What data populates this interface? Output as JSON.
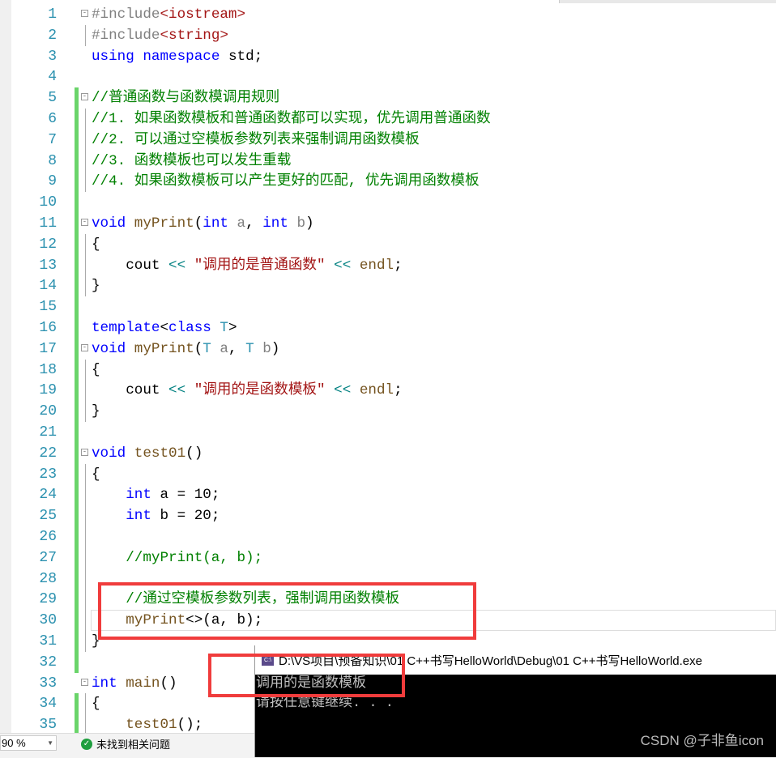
{
  "editor": {
    "lines": [
      [
        [
          "#include",
          "pp"
        ],
        [
          "<iostream>",
          "inc"
        ]
      ],
      [
        [
          "#include",
          "pp"
        ],
        [
          "<string>",
          "inc"
        ]
      ],
      [
        [
          "using",
          "k"
        ],
        [
          " ",
          "d"
        ],
        [
          "namespace",
          "k"
        ],
        [
          " std;",
          "d"
        ]
      ],
      [],
      [
        [
          "//普通函数与函数模调用规则",
          "c"
        ]
      ],
      [
        [
          "//1. 如果函数模板和普通函数都可以实现，优先调用普通函数",
          "c"
        ]
      ],
      [
        [
          "//2. 可以通过空模板参数列表来强制调用函数模板",
          "c"
        ]
      ],
      [
        [
          "//3. 函数模板也可以发生重载",
          "c"
        ]
      ],
      [
        [
          "//4. 如果函数模板可以产生更好的匹配, 优先调用函数模板",
          "c"
        ]
      ],
      [],
      [
        [
          "void",
          "k"
        ],
        [
          " ",
          "d"
        ],
        [
          "myPrint",
          "fn"
        ],
        [
          "(",
          "d"
        ],
        [
          "int",
          "k"
        ],
        [
          " ",
          "d"
        ],
        [
          "a",
          "p"
        ],
        [
          ", ",
          "d"
        ],
        [
          "int",
          "k"
        ],
        [
          " ",
          "d"
        ],
        [
          "b",
          "p"
        ],
        [
          ")",
          "d"
        ]
      ],
      [
        [
          "{",
          "d"
        ]
      ],
      [
        [
          "    cout ",
          "d"
        ],
        [
          "<<",
          "op"
        ],
        [
          " ",
          "d"
        ],
        [
          "\"调用的是普通函数\"",
          "s"
        ],
        [
          " ",
          "d"
        ],
        [
          "<<",
          "op"
        ],
        [
          " ",
          "d"
        ],
        [
          "endl",
          "fn"
        ],
        [
          ";",
          "d"
        ]
      ],
      [
        [
          "}",
          "d"
        ]
      ],
      [],
      [
        [
          "template",
          "k"
        ],
        [
          "<",
          "d"
        ],
        [
          "class",
          "k"
        ],
        [
          " ",
          "d"
        ],
        [
          "T",
          "t"
        ],
        [
          ">",
          "d"
        ]
      ],
      [
        [
          "void",
          "k"
        ],
        [
          " ",
          "d"
        ],
        [
          "myPrint",
          "fn"
        ],
        [
          "(",
          "d"
        ],
        [
          "T",
          "t"
        ],
        [
          " ",
          "d"
        ],
        [
          "a",
          "p"
        ],
        [
          ", ",
          "d"
        ],
        [
          "T",
          "t"
        ],
        [
          " ",
          "d"
        ],
        [
          "b",
          "p"
        ],
        [
          ")",
          "d"
        ]
      ],
      [
        [
          "{",
          "d"
        ]
      ],
      [
        [
          "    cout ",
          "d"
        ],
        [
          "<<",
          "op"
        ],
        [
          " ",
          "d"
        ],
        [
          "\"调用的是函数模板\"",
          "s"
        ],
        [
          " ",
          "d"
        ],
        [
          "<<",
          "op"
        ],
        [
          " ",
          "d"
        ],
        [
          "endl",
          "fn"
        ],
        [
          ";",
          "d"
        ]
      ],
      [
        [
          "}",
          "d"
        ]
      ],
      [],
      [
        [
          "void",
          "k"
        ],
        [
          " ",
          "d"
        ],
        [
          "test01",
          "fn"
        ],
        [
          "()",
          "d"
        ]
      ],
      [
        [
          "{",
          "d"
        ]
      ],
      [
        [
          "    ",
          "d"
        ],
        [
          "int",
          "k"
        ],
        [
          " a = 10;",
          "d"
        ]
      ],
      [
        [
          "    ",
          "d"
        ],
        [
          "int",
          "k"
        ],
        [
          " b = 20;",
          "d"
        ]
      ],
      [],
      [
        [
          "    //myPrint(a, b);",
          "c"
        ]
      ],
      [],
      [
        [
          "    //通过空模板参数列表，强制调用函数模板",
          "c"
        ]
      ],
      [
        [
          "    ",
          "d"
        ],
        [
          "myPrint",
          "fn"
        ],
        [
          "<>(a, b);",
          "d"
        ]
      ],
      [
        [
          "}",
          "d"
        ]
      ],
      [],
      [
        [
          "int",
          "k"
        ],
        [
          " ",
          "d"
        ],
        [
          "main",
          "fn"
        ],
        [
          "()",
          "d"
        ]
      ],
      [
        [
          "{",
          "d"
        ]
      ],
      [
        [
          "    ",
          "d"
        ],
        [
          "test01",
          "fn"
        ],
        [
          "();",
          "d"
        ]
      ]
    ],
    "changed_lines": [
      5,
      6,
      7,
      8,
      9,
      10,
      11,
      12,
      13,
      14,
      15,
      16,
      17,
      18,
      19,
      20,
      21,
      22,
      23,
      24,
      25,
      26,
      27,
      28,
      29,
      30,
      31,
      32,
      34,
      35
    ],
    "fold_lines": [
      1,
      5,
      11,
      17,
      22,
      33
    ],
    "current_line": 30
  },
  "status": {
    "zoom": "90 %",
    "issues": "未找到相关问题"
  },
  "console": {
    "title": "D:\\VS项目\\预备知识\\01 C++书写HelloWorld\\Debug\\01 C++书写HelloWorld.exe",
    "output": [
      "调用的是函数模板",
      "请按任意键继续. . ."
    ]
  },
  "watermark": "CSDN @子非鱼icon",
  "colors": {
    "keyword": "#0000ff",
    "comment": "#008000",
    "string": "#a31515",
    "highlight_box": "#f03c3c"
  }
}
